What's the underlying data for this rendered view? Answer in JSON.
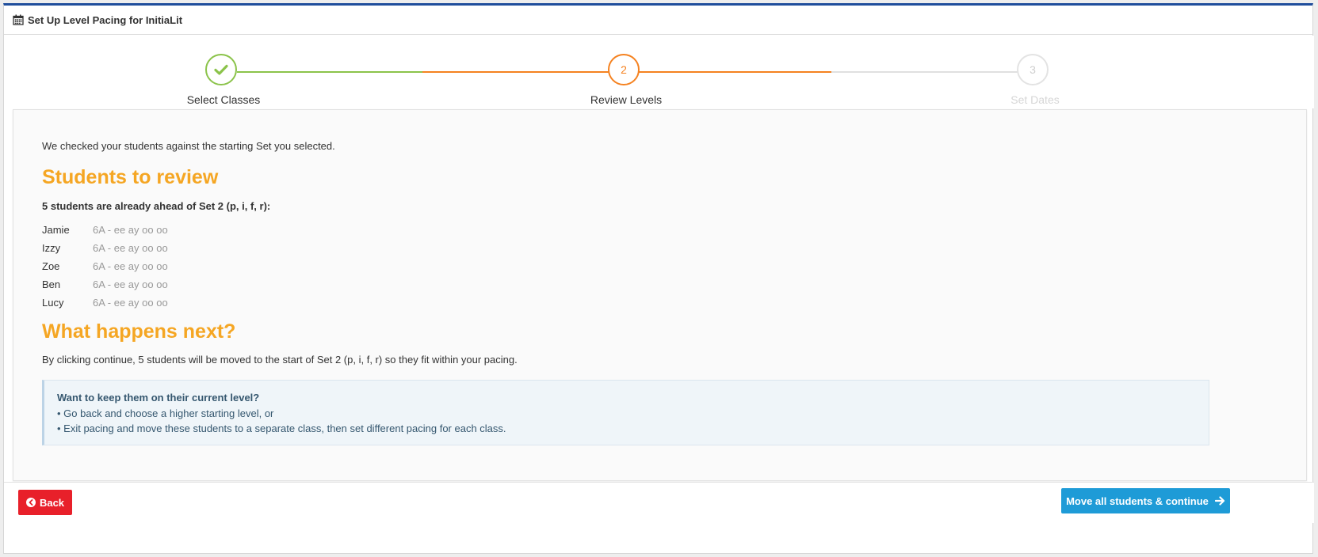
{
  "window": {
    "title": "Set Up Level Pacing for InitiaLit"
  },
  "icons": {
    "title": "calendar-icon",
    "step1": "check-icon",
    "back": "arrow-circle-left-icon",
    "continue": "arrow-right-icon"
  },
  "colors": {
    "accent_bar": "#1f4e9c",
    "done": "#8bc34a",
    "active": "#f58220",
    "pending": "#dddddd",
    "heading": "#f5a623",
    "back_button": "#e8202a",
    "continue_button": "#1e9bd7"
  },
  "stepper": {
    "steps": [
      {
        "number": "",
        "label": "Select Classes",
        "state": "complete"
      },
      {
        "number": "2",
        "label": "Review Levels",
        "state": "active"
      },
      {
        "number": "3",
        "label": "Set Dates",
        "state": "pending"
      }
    ]
  },
  "main": {
    "intro": "We checked your students against the starting Set you selected.",
    "review_heading": "Students to review",
    "review_subheading": "5 students are already ahead of Set 2 (p, i, f, r):",
    "students": [
      {
        "name": "Jamie",
        "class": "6A - ee ay oo oo"
      },
      {
        "name": "Izzy",
        "class": "6A - ee ay oo oo"
      },
      {
        "name": "Zoe",
        "class": "6A - ee ay oo oo"
      },
      {
        "name": "Ben",
        "class": "6A - ee ay oo oo"
      },
      {
        "name": "Lucy",
        "class": "6A - ee ay oo oo"
      }
    ],
    "next_heading": "What happens next?",
    "next_text": "By clicking continue, 5 students will be moved to the start of Set 2 (p, i, f, r) so they fit within your pacing.",
    "info": {
      "title": "Want to keep them on their current level?",
      "lines": [
        "• Go back and choose a higher starting level, or",
        "• Exit pacing and move these students to a separate class, then set different pacing for each class."
      ]
    }
  },
  "footer": {
    "back_label": "Back",
    "continue_label": "Move all students & continue"
  }
}
